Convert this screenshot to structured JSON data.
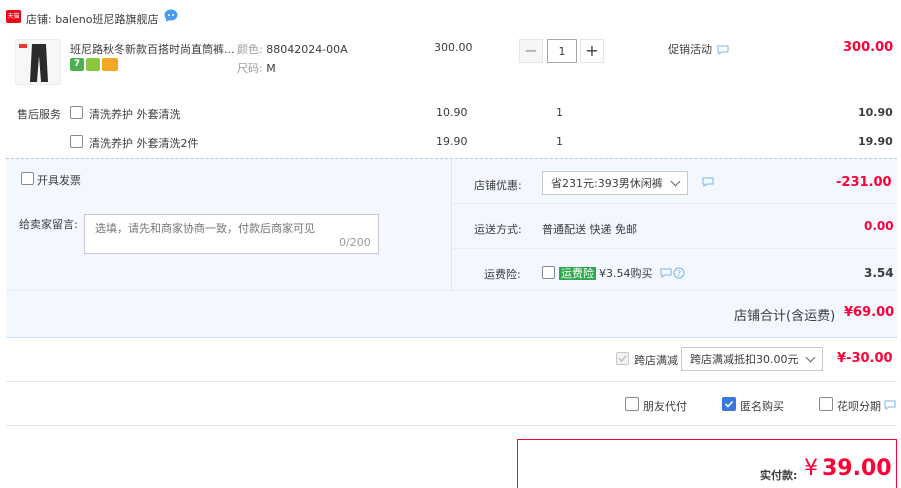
{
  "shop": {
    "badge": "天猫",
    "label": "店铺: baleno班尼路旗舰店"
  },
  "item": {
    "title": "班尼路秋冬新款百搭时尚直筒裤...",
    "sku_color_label": "颜色:",
    "sku_color_value": "88042024-00A",
    "sku_size_label": "尺码:",
    "sku_size_value": "M",
    "unit_price": "300.00",
    "quantity": "1",
    "promo_label": "促销活动",
    "total": "300.00"
  },
  "after_sale": {
    "label": "售后服务",
    "options": [
      {
        "name": "清洗养护 外套清洗",
        "price": "10.90",
        "qty": "1",
        "total": "10.90"
      },
      {
        "name": "清洗养护 外套清洗2件",
        "price": "19.90",
        "qty": "1",
        "total": "19.90"
      }
    ]
  },
  "invoice_label": "开具发票",
  "message": {
    "label": "给卖家留言:",
    "placeholder": "选填，请先和商家协商一致，付款后商家可见",
    "counter": "0/200"
  },
  "discount": {
    "label": "店铺优惠:",
    "selected": "省231元:393男休闲裤",
    "amount": "-231.00"
  },
  "shipping": {
    "label": "运送方式:",
    "value": "普通配送 快递 免邮",
    "amount": "0.00"
  },
  "insurance": {
    "label": "运费险:",
    "tag": "运费险",
    "text": "¥3.54购买",
    "amount": "3.54"
  },
  "shop_total": {
    "label": "店铺合计(含运费)",
    "amount": "¥69.00"
  },
  "cross_store": {
    "label": "跨店满减",
    "selected": "跨店满减抵扣30.00元",
    "amount": "¥-30.00"
  },
  "options": {
    "friend_pay": "朋友代付",
    "anonymous": "匿名购买",
    "huabei": "花呗分期"
  },
  "payment": {
    "label": "实付款:",
    "currency": "¥",
    "amount": "39.00"
  },
  "colors": {
    "accent": "#ff0036",
    "panel": "#f3f7ff",
    "checkbox_on": "#3a78e0"
  }
}
